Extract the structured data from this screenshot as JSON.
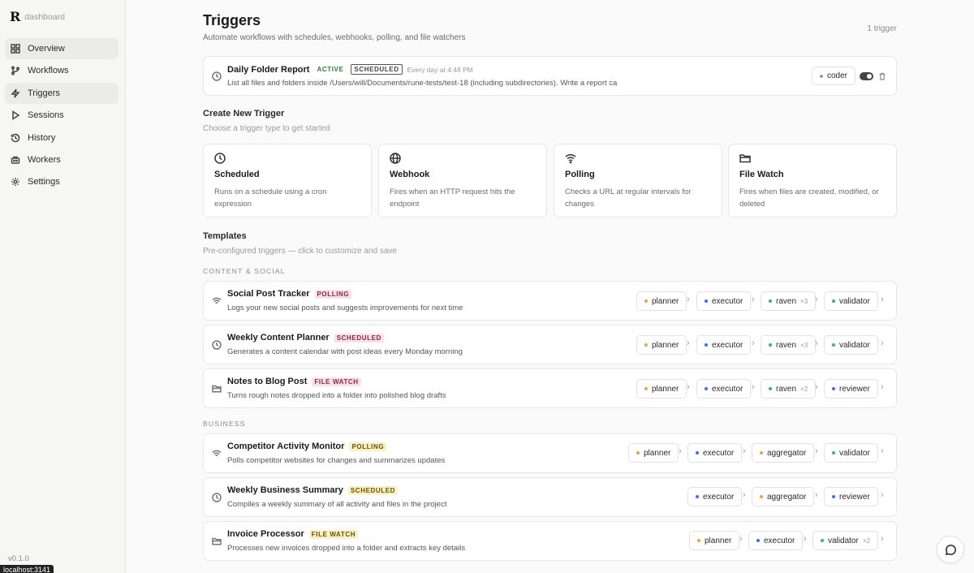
{
  "app": {
    "logo": "R",
    "name": "dashboard",
    "version": "v0.1.0",
    "url_tip": "localhost:3141"
  },
  "sidebar": {
    "items": [
      {
        "label": "Overview",
        "icon": "grid-icon"
      },
      {
        "label": "Workflows",
        "icon": "branch-icon"
      },
      {
        "label": "Triggers",
        "icon": "bolt-icon"
      },
      {
        "label": "Sessions",
        "icon": "play-icon"
      },
      {
        "label": "History",
        "icon": "history-icon"
      },
      {
        "label": "Workers",
        "icon": "workers-icon"
      },
      {
        "label": "Settings",
        "icon": "gear-icon"
      }
    ]
  },
  "header": {
    "title": "Triggers",
    "subtitle": "Automate workflows with schedules, webhooks, polling, and file watchers",
    "count": "1 trigger"
  },
  "active_trigger": {
    "title": "Daily Folder Report",
    "status": "ACTIVE",
    "type": "SCHEDULED",
    "schedule": "Every day at 4:48 PM",
    "description": "List all files and folders inside /Users/will/Documents/rune-tests/test-18 (including subdirectories). Write a report ca",
    "agent": "coder",
    "enabled": true
  },
  "create": {
    "title": "Create New Trigger",
    "subtitle": "Choose a trigger type to get started",
    "types": [
      {
        "title": "Scheduled",
        "desc": "Runs on a schedule using a cron expression",
        "icon": "clock-icon"
      },
      {
        "title": "Webhook",
        "desc": "Fires when an HTTP request hits the endpoint",
        "icon": "globe-icon"
      },
      {
        "title": "Polling",
        "desc": "Checks a URL at regular intervals for changes",
        "icon": "wifi-icon"
      },
      {
        "title": "File Watch",
        "desc": "Fires when files are created, modified, or deleted",
        "icon": "folder-icon"
      }
    ]
  },
  "templates": {
    "title": "Templates",
    "subtitle": "Pre-configured triggers — click to customize and save",
    "groups": [
      {
        "label": "CONTENT & SOCIAL",
        "items": [
          {
            "title": "Social Post Tracker",
            "badge": "POLLING",
            "desc": "Logs your new social posts and suggests improvements for next time",
            "agents": [
              "planner",
              "executor",
              "raven",
              "validator"
            ],
            "raven_mult": "×3"
          },
          {
            "title": "Weekly Content Planner",
            "badge": "SCHEDULED",
            "desc": "Generates a content calendar with post ideas every Monday morning",
            "agents": [
              "planner",
              "executor",
              "raven",
              "validator"
            ],
            "raven_mult": "×3"
          },
          {
            "title": "Notes to Blog Post",
            "badge": "FILE WATCH",
            "desc": "Turns rough notes dropped into a folder into polished blog drafts",
            "agents": [
              "planner",
              "executor",
              "raven",
              "reviewer"
            ],
            "raven_mult": "×2"
          }
        ]
      },
      {
        "label": "BUSINESS",
        "items": [
          {
            "title": "Competitor Activity Monitor",
            "badge": "POLLING",
            "desc": "Polls competitor websites for changes and summarizes updates",
            "agents": [
              "planner",
              "executor",
              "aggregator",
              "validator"
            ]
          },
          {
            "title": "Weekly Business Summary",
            "badge": "SCHEDULED",
            "desc": "Compiles a weekly summary of all activity and files in the project",
            "agents": [
              "executor",
              "aggregator",
              "reviewer"
            ]
          },
          {
            "title": "Invoice Processor",
            "badge": "FILE WATCH",
            "desc": "Processes new invoices dropped into a folder and extracts key details",
            "agents": [
              "planner",
              "executor",
              "validator"
            ],
            "validator_mult": "×2"
          }
        ]
      }
    ]
  },
  "colors": {
    "planner": "#f0a23b",
    "executor": "#3b6ef0",
    "raven": "#3bb56a",
    "validator": "#3bb56a",
    "reviewer": "#3b6ef0",
    "aggregator": "#f0a23b",
    "coder": "#999999"
  }
}
